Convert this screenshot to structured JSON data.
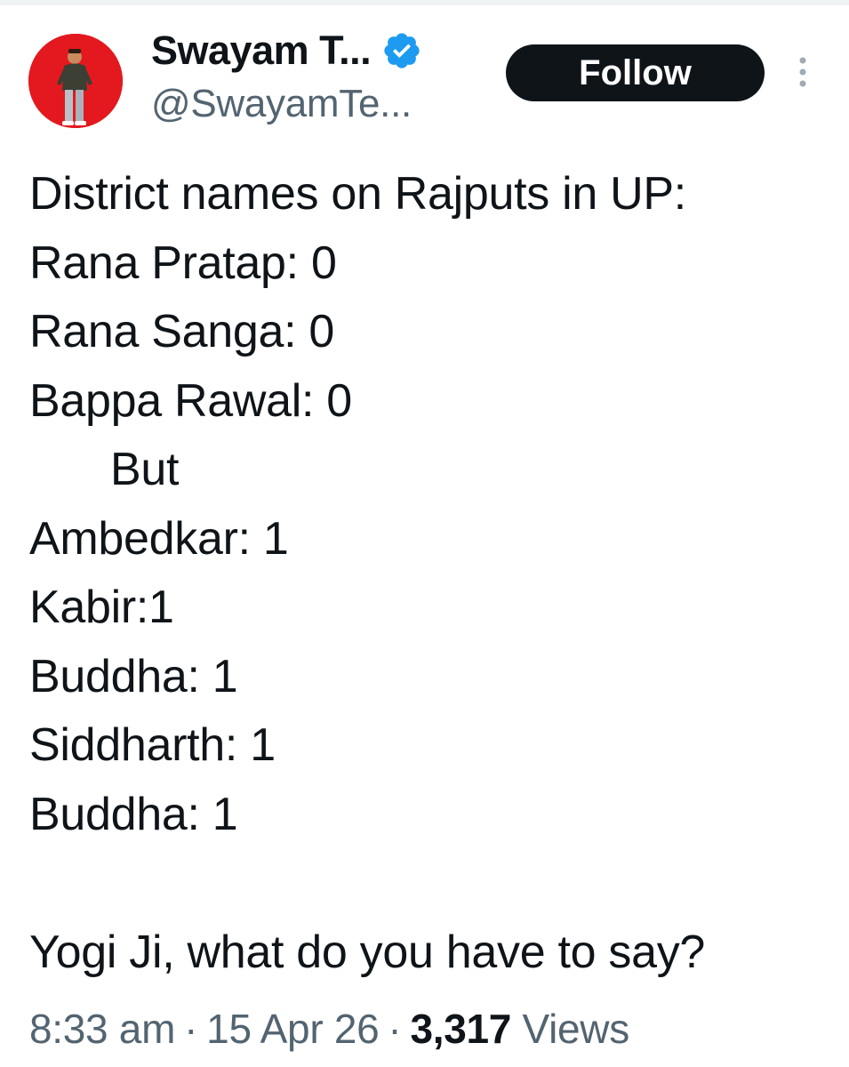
{
  "author": {
    "display_name": "Swayam T...",
    "handle": "@SwayamTe...",
    "verified_icon": "verified-badge-icon",
    "verified_color": "#1d9bf0",
    "avatar_bg": "#e3191f"
  },
  "actions": {
    "follow_label": "Follow",
    "more_icon": "more-vertical-icon"
  },
  "tweet": {
    "lines": [
      "District names on Rajputs in UP:",
      "Rana Pratap: 0",
      "Rana Sanga: 0",
      "Bappa Rawal: 0",
      "But",
      "Ambedkar: 1",
      "Kabir:1",
      "Buddha: 1",
      "Siddharth: 1",
      "Buddha: 1",
      "",
      "Yogi Ji, what do you have to say?"
    ]
  },
  "meta": {
    "time": "8:33 am",
    "separator": "·",
    "date": "15 Apr 26",
    "views_count": "3,317",
    "views_label": "Views"
  }
}
